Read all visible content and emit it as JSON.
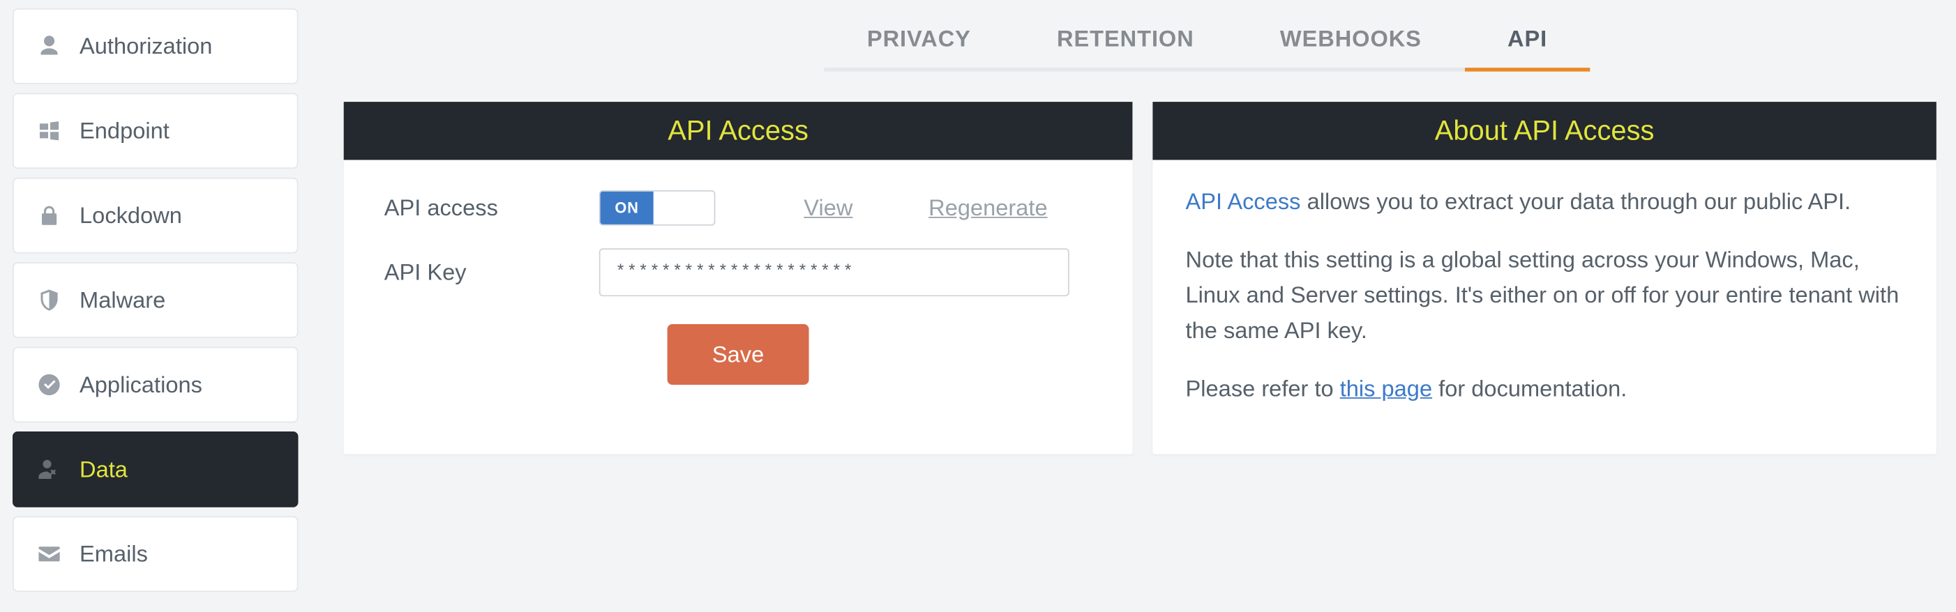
{
  "sidebar": {
    "items": [
      {
        "label": "Authorization"
      },
      {
        "label": "Endpoint"
      },
      {
        "label": "Lockdown"
      },
      {
        "label": "Malware"
      },
      {
        "label": "Applications"
      },
      {
        "label": "Data"
      },
      {
        "label": "Emails"
      }
    ]
  },
  "tabs": {
    "privacy": "PRIVACY",
    "retention": "RETENTION",
    "webhooks": "WEBHOOKS",
    "api": "API"
  },
  "leftPanel": {
    "title": "API Access",
    "apiAccessLabel": "API access",
    "toggleText": "ON",
    "viewLink": "View",
    "regenLink": "Regenerate",
    "apiKeyLabel": "API Key",
    "apiKeyValue": "*********************",
    "saveBtn": "Save"
  },
  "rightPanel": {
    "title": "About API Access",
    "highlight": "API Access",
    "p1rest": " allows you to extract your data through our public API.",
    "p2": "Note that this setting is a global setting across your Windows, Mac, Linux and Server settings. It's either on or off for your entire tenant with the same API key.",
    "p3pre": "Please refer to ",
    "p3link": "this page",
    "p3post": " for documentation."
  }
}
